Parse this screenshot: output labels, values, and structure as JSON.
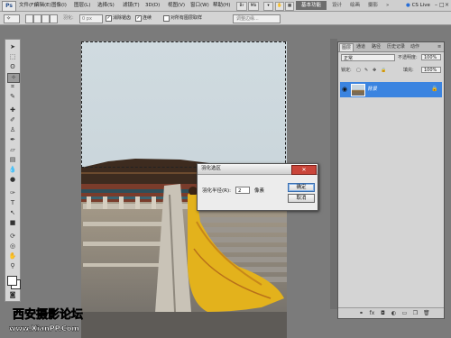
{
  "app": {
    "logo": "Ps"
  },
  "menu": [
    "文件(F)",
    "编辑(E)",
    "图像(I)",
    "图层(L)",
    "选择(S)",
    "滤镜(T)",
    "3D(D)",
    "视图(V)",
    "窗口(W)",
    "帮助(H)"
  ],
  "titlebar": {
    "workspaces": [
      "基本功能",
      "设计",
      "绘画",
      "摄影"
    ],
    "cs_live": "CS Live"
  },
  "options": {
    "feather_label": "羽化:",
    "feather_value": "0 px",
    "antialias_label": "消除锯齿",
    "contiguous_label": "连续",
    "all_layers_label": "对所有图层取样",
    "refine_edge_label": "调整边缘..."
  },
  "dialog": {
    "title": "羽化选区",
    "radius_label": "羽化半径(R):",
    "radius_value": "2",
    "unit": "像素",
    "ok": "确定",
    "cancel": "取消",
    "close": "✕"
  },
  "layers_panel": {
    "tabs": [
      "图层",
      "通道",
      "路径",
      "历史记录",
      "动作"
    ],
    "blend_mode": "正常",
    "opacity_label": "不透明度:",
    "opacity_value": "100%",
    "lock_label": "锁定:",
    "fill_label": "填充:",
    "fill_value": "100%",
    "layers": [
      {
        "name": "背景",
        "locked": true,
        "visible": true
      }
    ]
  },
  "watermark": {
    "line1": "西安摄影论坛",
    "line2": "www.XianPP.Com"
  },
  "colors": {
    "selection_highlight": "#3b84e0",
    "dialog_close": "#c9453a",
    "app_background": "#7b7b7b"
  }
}
